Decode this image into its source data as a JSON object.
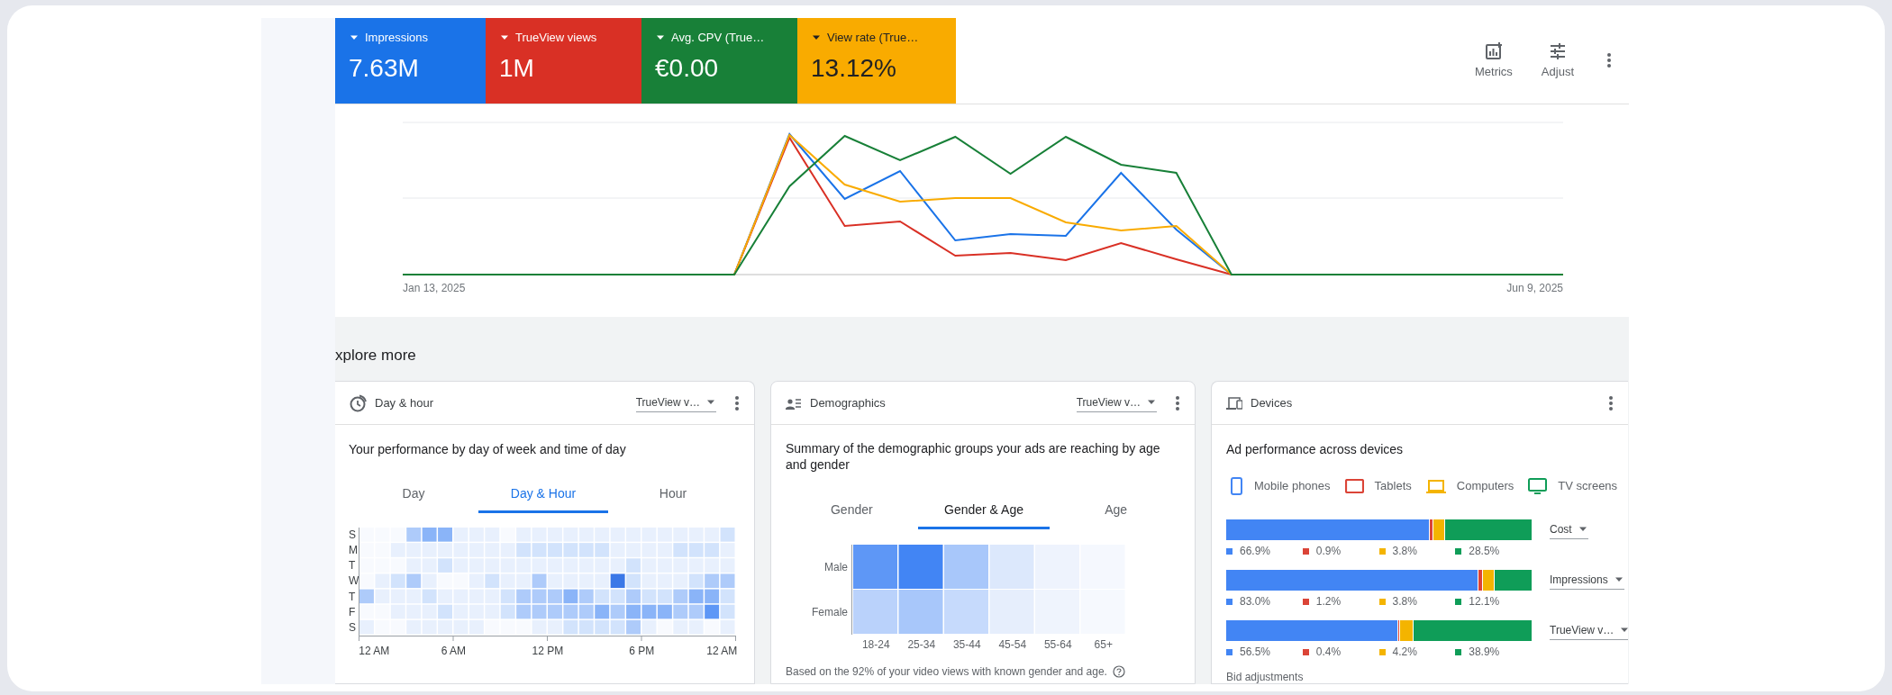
{
  "metric_tiles": [
    {
      "label": "Impressions",
      "value": "7.63M",
      "color": "#1a73e8"
    },
    {
      "label": "TrueView views",
      "value": "1M",
      "color": "#d93025"
    },
    {
      "label": "Avg. CPV (True…",
      "value": "€0.00",
      "color": "#188038"
    },
    {
      "label": "View rate (True…",
      "value": "13.12%",
      "color": "#f9ab00"
    }
  ],
  "chart_actions": [
    {
      "label": "Metrics",
      "kind": "metrics"
    },
    {
      "label": "Adjust",
      "kind": "adjust"
    }
  ],
  "line_chart": {
    "start_label": "Jan 13, 2025",
    "end_label": "Jun 9, 2025"
  },
  "section_title": "xplore more",
  "day_hour_card": {
    "title": "Day & hour",
    "metric_dropdown": "TrueView v…",
    "subtitle": "Your performance by day of week and time of day",
    "tabs": [
      {
        "label": "Day",
        "selected": false
      },
      {
        "label": "Day & Hour",
        "selected": true
      },
      {
        "label": "Hour",
        "selected": false
      }
    ],
    "day_labels": [
      "S",
      "M",
      "T",
      "W",
      "T",
      "F",
      "S"
    ],
    "hour_labels": [
      "12 AM",
      "6 AM",
      "12 PM",
      "6 PM",
      "12 AM"
    ]
  },
  "demographics_card": {
    "title": "Demographics",
    "metric_dropdown": "TrueView v…",
    "subtitle": "Summary of the demographic groups your ads are reaching by age and gender",
    "tabs": [
      {
        "label": "Gender",
        "selected": false
      },
      {
        "label": "Gender & Age",
        "selected": true
      },
      {
        "label": "Age",
        "selected": false
      }
    ],
    "gender_labels": [
      "Male",
      "Female"
    ],
    "age_labels": [
      "18-24",
      "25-34",
      "35-44",
      "45-54",
      "55-64",
      "65+"
    ],
    "footnote": "Based on the 92% of your video views with known gender and age."
  },
  "devices_card": {
    "title": "Devices",
    "subtitle": "Ad performance across devices",
    "legend": [
      {
        "label": "Mobile phones",
        "color": "#4285f4",
        "kind": "phone"
      },
      {
        "label": "Tablets",
        "color": "#db4437",
        "kind": "tablet"
      },
      {
        "label": "Computers",
        "color": "#f4b400",
        "kind": "laptop"
      },
      {
        "label": "TV screens",
        "color": "#0f9d58",
        "kind": "tv"
      }
    ],
    "rows": [
      {
        "metric": "Cost",
        "shares": [
          "66.9%",
          "0.9%",
          "3.8%",
          "28.5%"
        ]
      },
      {
        "metric": "Impressions",
        "shares": [
          "83.0%",
          "1.2%",
          "3.8%",
          "12.1%"
        ]
      },
      {
        "metric": "TrueView v…",
        "shares": [
          "56.5%",
          "0.4%",
          "4.2%",
          "38.9%"
        ]
      }
    ],
    "bid_adjustments": "Bid adjustments"
  }
}
